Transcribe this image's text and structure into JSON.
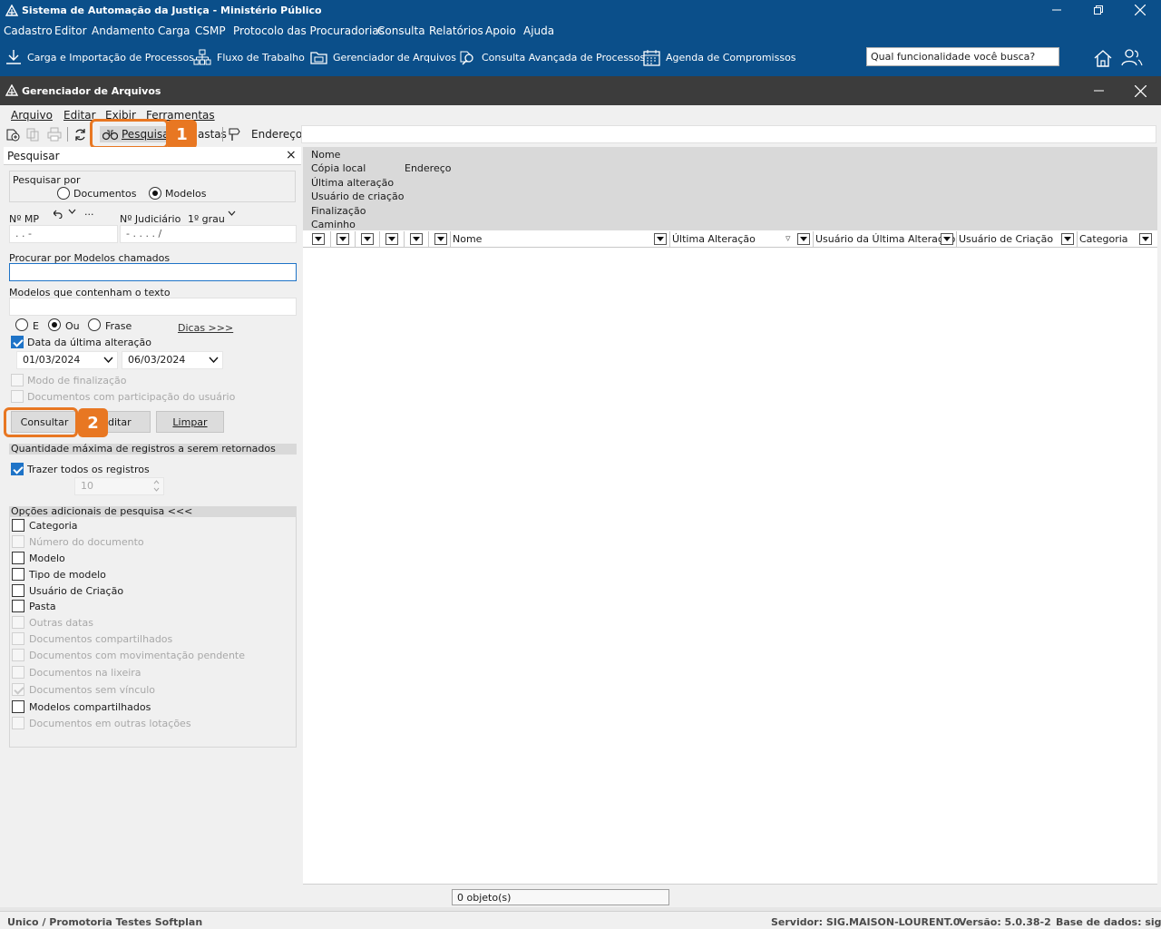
{
  "app": {
    "title": "Sistema de Automação da Justiça - Ministério Público"
  },
  "main_menu": [
    "Cadastro",
    "Editor",
    "Andamento",
    "Carga",
    "CSMP",
    "Protocolo das Procuradorias",
    "Consulta",
    "Relatórios",
    "Apoio",
    "Ajuda"
  ],
  "main_toolbar": {
    "items": [
      {
        "label": "Carga e Importação de Processos",
        "icon": "download-icon"
      },
      {
        "label": "Fluxo de Trabalho",
        "icon": "workflow-icon"
      },
      {
        "label": "Gerenciador de Arquivos",
        "icon": "file-manager-icon"
      },
      {
        "label": "Consulta Avançada de Processos",
        "icon": "advanced-search-icon"
      },
      {
        "label": "Agenda de Compromissos",
        "icon": "calendar-icon"
      }
    ],
    "search_value": "Qual funcionalidade você busca?"
  },
  "child_window": {
    "title": "Gerenciador de Arquivos",
    "menu": [
      "Arquivo",
      "Editar",
      "Exibir",
      "Ferramentas"
    ],
    "tools": {
      "pesquisar": "Pesquisar",
      "pastas_partial": "astas",
      "endereco": "Endereço"
    },
    "callouts": [
      "1",
      "2"
    ]
  },
  "search_panel": {
    "header": "Pesquisar",
    "close": "×",
    "search_by_label": "Pesquisar por",
    "opt_documentos": "Documentos",
    "opt_modelos": "Modelos",
    "nmp_label": "Nº MP",
    "njud_label": "Nº Judiciário",
    "grau": "1º grau",
    "nmp_mask": ".   .       -",
    "njud_mask": "-   .   .   .   .       /",
    "more": "···",
    "modelos_chamados_label": "Procurar por Modelos chamados",
    "modelos_texto_label": "Modelos que contenham o texto",
    "op_e": "E",
    "op_ou": "Ou",
    "op_frase": "Frase",
    "dicas": "Dicas >>>",
    "data_ultima_alteracao": "Data da última alteração",
    "date_from": "01/03/2024",
    "date_to": "06/03/2024",
    "modo_finalizacao": "Modo de finalização",
    "docs_participacao": "Documentos com participação do usuário",
    "btn_consultar": "Consultar",
    "btn_editar_partial": "ditar",
    "btn_limpar": "Limpar",
    "qtd_max_label": "Quantidade máxima de registros a serem retornados",
    "trazer_todos": "Trazer todos os registros",
    "qtd_value": "10",
    "opcoes_label": "Opções adicionais de pesquisa <<<",
    "options": [
      {
        "label": "Categoria",
        "enabled": true,
        "checked": false
      },
      {
        "label": "Número do documento",
        "enabled": false,
        "checked": false
      },
      {
        "label": "Modelo",
        "enabled": true,
        "checked": false
      },
      {
        "label": "Tipo de modelo",
        "enabled": true,
        "checked": false
      },
      {
        "label": "Usuário de Criação",
        "enabled": true,
        "checked": false
      },
      {
        "label": "Pasta",
        "enabled": true,
        "checked": false
      },
      {
        "label": "Outras datas",
        "enabled": false,
        "checked": false
      },
      {
        "label": "Documentos compartilhados",
        "enabled": false,
        "checked": false
      },
      {
        "label": "Documentos com movimentação pendente",
        "enabled": false,
        "checked": false
      },
      {
        "label": "Documentos na lixeira",
        "enabled": false,
        "checked": false
      },
      {
        "label": "Documentos sem vínculo",
        "enabled": false,
        "checked": true
      },
      {
        "label": "Modelos compartilhados",
        "enabled": true,
        "checked": false
      },
      {
        "label": "Documentos em outras lotações",
        "enabled": false,
        "checked": false
      }
    ]
  },
  "details": {
    "nome": "Nome",
    "copia_local": "Cópia local",
    "endereco": "Endereço",
    "ultima_alteracao": "Última alteração",
    "usuario_criacao": "Usuário de criação",
    "finalizacao": "Finalização",
    "caminho": "Caminho"
  },
  "grid": {
    "col_nome": "Nome",
    "col_ultima": "Última Alteração",
    "col_usuario_ultima": "Usuário da Última Alteração",
    "col_usuario_criacao": "Usuário de Criação",
    "col_categoria": "Categoria",
    "count": "0 objeto(s)"
  },
  "status": {
    "lotacao": "Unico / Promotoria Testes Softplan",
    "servidor": "Servidor: SIG.MAISON-LOURENT.0",
    "versao": "Versão: 5.0.38-2",
    "base": "Base de dados: sigal"
  },
  "colors": {
    "title_blue": "#0b4f8a",
    "child_title": "#3c3c3c",
    "callout_orange": "#e87722",
    "check_blue": "#1e73c7"
  }
}
